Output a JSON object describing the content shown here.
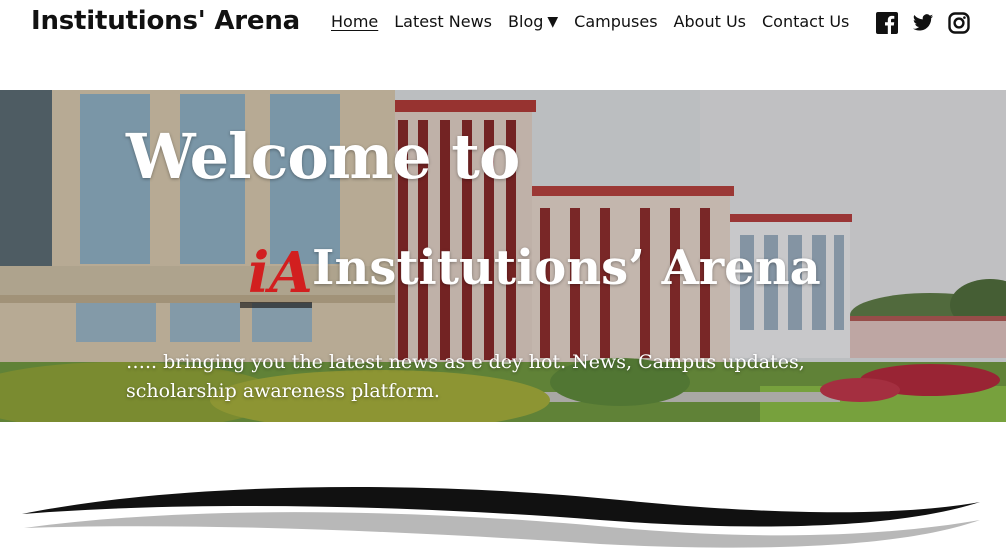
{
  "header": {
    "site_title": "Institutions' Arena",
    "nav": [
      {
        "label": "Home",
        "active": true
      },
      {
        "label": "Latest News"
      },
      {
        "label": "Blog",
        "caret": "▼"
      },
      {
        "label": "Campuses"
      },
      {
        "label": "About Us"
      },
      {
        "label": "Contact Us"
      }
    ],
    "social_icons": [
      "facebook-icon",
      "twitter-icon",
      "instagram-icon"
    ]
  },
  "hero": {
    "heading": "Welcome to",
    "brand": "Institutions’ Arena",
    "logo_text": "iA",
    "tagline": "….. bringing you the latest news as e dey hot. News, Campus updates, scholarship awareness platform."
  },
  "colors": {
    "text": "#111111",
    "hero_text": "#ffffff",
    "logo_red": "#d21f1f",
    "building_red": "#8e2b2b",
    "grass": "#7da846",
    "sky": "#dfe3e6"
  }
}
